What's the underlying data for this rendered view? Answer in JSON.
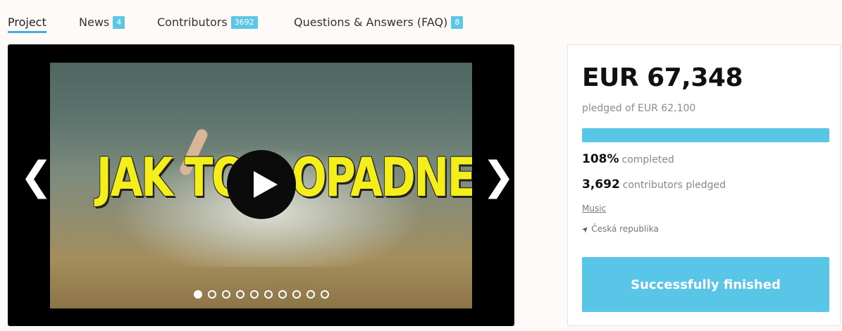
{
  "tabs": [
    {
      "label": "Project",
      "badge": null,
      "active": true
    },
    {
      "label": "News",
      "badge": "4",
      "active": false
    },
    {
      "label": "Contributors",
      "badge": "3692",
      "active": false
    },
    {
      "label": "Questions & Answers (FAQ)",
      "badge": "8",
      "active": false
    }
  ],
  "video": {
    "overlay_text": "JAK TO DOPADNE ?",
    "prev_arrow": "❮",
    "next_arrow": "❯",
    "slide_count": 10,
    "current_slide": 1
  },
  "stats": {
    "amount": "EUR 67,348",
    "pledged_of": "pledged of EUR 62,100",
    "progress_percent": 100,
    "completed_value": "108%",
    "completed_label": "completed",
    "contributors_value": "3,692",
    "contributors_label": "contributors pledged",
    "category": "Music",
    "location": "Česká republika",
    "status_button": "Successfully finished"
  },
  "colors": {
    "accent": "#59c5e7",
    "overlay_text": "#f4ee1a"
  },
  "icons": {
    "prev": "chevron-left-icon",
    "next": "chevron-right-icon",
    "play": "play-icon",
    "location": "location-arrow-icon"
  }
}
